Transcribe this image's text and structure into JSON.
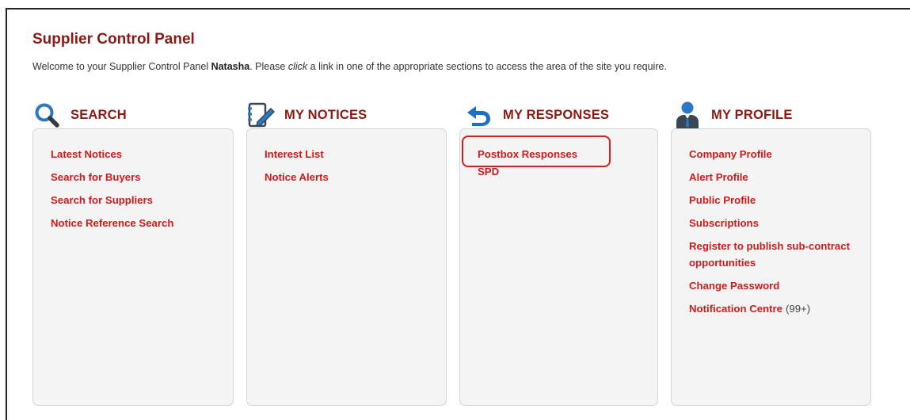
{
  "header": {
    "title": "Supplier Control Panel",
    "welcome_before": "Welcome to your Supplier Control Panel ",
    "user_name": "Natasha",
    "welcome_mid": ". Please ",
    "welcome_click": "click",
    "welcome_after": " a link in one of the appropriate sections to access the area of the site you require."
  },
  "colors": {
    "heading": "#8b1a14",
    "link": "#d21a1a",
    "panel_bg": "#f4f4f4",
    "highlight": "#d81e1e"
  },
  "sections": {
    "search": {
      "title": "SEARCH",
      "icon": "magnifier-icon",
      "links": [
        "Latest Notices",
        "Search for Buyers",
        "Search for Suppliers",
        "Notice Reference Search"
      ]
    },
    "notices": {
      "title": "MY NOTICES",
      "icon": "notepad-pencil-icon",
      "links": [
        "Interest List",
        "Notice Alerts"
      ]
    },
    "responses": {
      "title": "MY RESPONSES",
      "icon": "return-arrow-icon",
      "links": [
        "Postbox Responses",
        "SPD"
      ]
    },
    "profile": {
      "title": "MY PROFILE",
      "icon": "user-profile-icon",
      "links": [
        "Company Profile",
        "Alert Profile",
        "Public Profile",
        "Subscriptions",
        "Register to publish sub-contract opportunities",
        "Change Password",
        "Notification Centre"
      ],
      "notification_count": "(99+)"
    }
  }
}
